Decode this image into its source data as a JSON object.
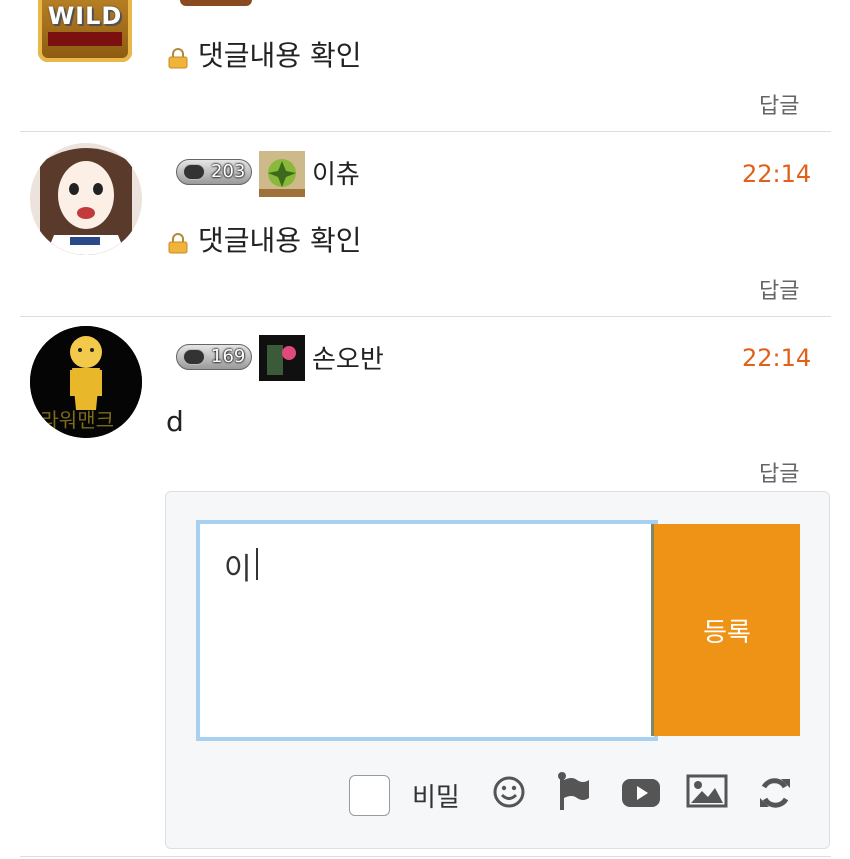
{
  "comments": [
    {
      "avatar_label": "WILD",
      "content": "댓글내용 확인",
      "reply_label": "답글",
      "locked": true
    },
    {
      "level": "203",
      "nickname": "이츄",
      "time": "22:14",
      "content": "댓글내용 확인",
      "reply_label": "답글",
      "locked": true
    },
    {
      "level": "169",
      "nickname": "손오반",
      "avatar_text": "프라워맨크",
      "time": "22:14",
      "content": "d",
      "reply_label": "답글",
      "locked": false
    }
  ],
  "reply_form": {
    "input_value": "이",
    "submit_label": "등록",
    "secret_label": "비밀",
    "secret_checked": false
  },
  "toolbar_icons": [
    "smiley-icon",
    "flag-icon",
    "youtube-icon",
    "image-icon",
    "refresh-icon"
  ],
  "colors": {
    "time": "#e0621a",
    "submit_bg": "#ef9316",
    "input_border": "#a8d0f0"
  }
}
